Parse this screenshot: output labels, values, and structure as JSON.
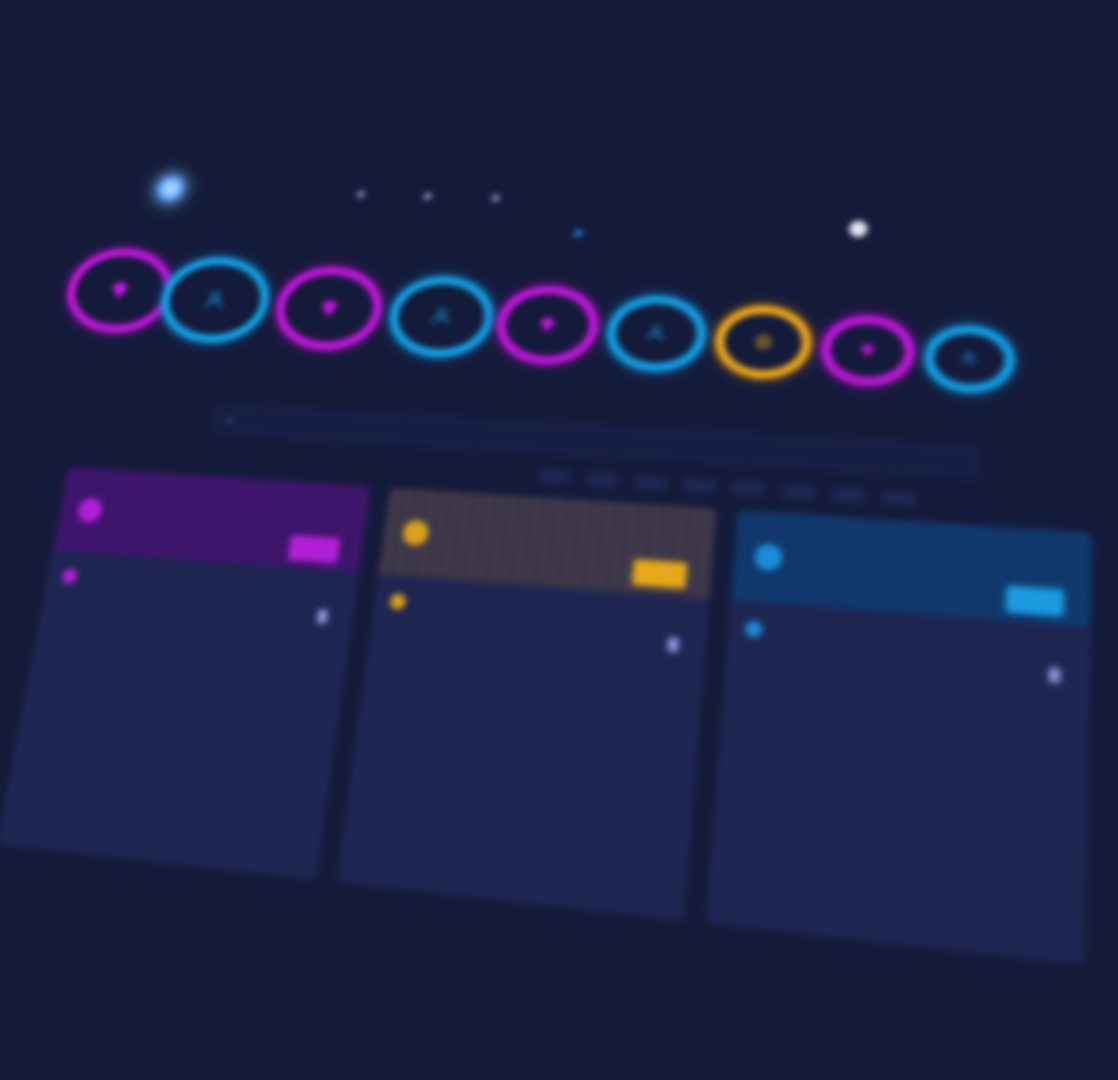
{
  "app": {
    "logo_text": ""
  },
  "nav": {
    "items": [
      {
        "label": "",
        "icon": "dashboard-icon"
      },
      {
        "label": "",
        "icon": "settings-icon"
      },
      {
        "label": "",
        "icon": "filter-icon"
      }
    ]
  },
  "subbar": {
    "label": ""
  },
  "tools": {
    "help_label": "",
    "user_label": ""
  },
  "strip": {
    "items": [
      {
        "icon": "diamond-icon",
        "color": "#c615e0"
      },
      {
        "icon": "user-icon",
        "color": "#11a3e8"
      },
      {
        "icon": "diamond-icon",
        "color": "#c615e0"
      },
      {
        "icon": "user-icon",
        "color": "#11a3e8"
      },
      {
        "icon": "diamond-icon",
        "color": "#c615e0"
      },
      {
        "icon": "user-icon",
        "color": "#11a3e8"
      },
      {
        "icon": "coin-icon",
        "color": "#f1aa17"
      },
      {
        "icon": "diamond-icon",
        "color": "#c615e0"
      },
      {
        "icon": "user-icon",
        "color": "#11a3e8"
      }
    ]
  },
  "search": {
    "placeholder": ""
  },
  "columns": [
    {
      "title": "",
      "button": "",
      "subtitle": "",
      "doc_count": "",
      "accent": "#b11fd6",
      "rows": [
        {
          "name": "",
          "value": ""
        },
        {
          "name": "",
          "value": ""
        },
        {
          "name": "",
          "value": ""
        },
        {
          "name": "",
          "value": ""
        },
        {
          "name": "",
          "value": ""
        },
        {
          "name": "",
          "value": ""
        }
      ]
    },
    {
      "title": "",
      "button": "",
      "subtitle": "",
      "doc_count": "",
      "accent": "#e6a818",
      "rows": [
        {
          "name": "",
          "value": ""
        },
        {
          "name": "",
          "value": ""
        }
      ]
    },
    {
      "title": "",
      "button": "",
      "subtitle": "",
      "doc_count": "",
      "accent": "#1a9be0",
      "rows": [
        {
          "name": "",
          "value": ""
        },
        {
          "name": "",
          "value": ""
        },
        {
          "name": "",
          "value": ""
        },
        {
          "name": "",
          "value": ""
        }
      ]
    }
  ]
}
